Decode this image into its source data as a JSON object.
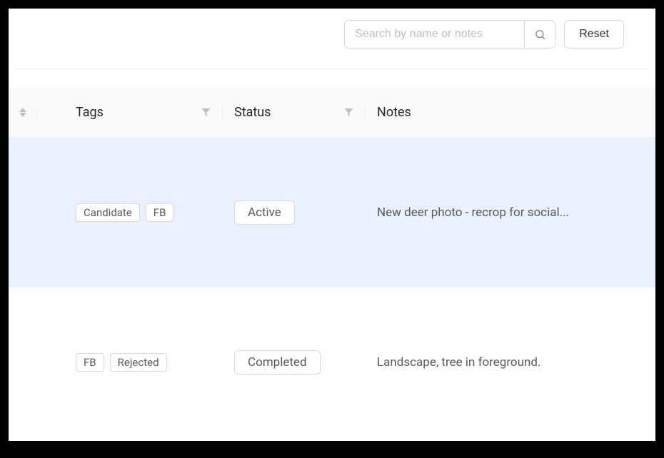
{
  "toolbar": {
    "search_placeholder": "Search by name or notes",
    "reset_label": "Reset"
  },
  "columns": {
    "tags": "Tags",
    "status": "Status",
    "notes": "Notes"
  },
  "rows": [
    {
      "tags": [
        "Candidate",
        "FB"
      ],
      "status": "Active",
      "notes": "New deer photo - recrop for social...",
      "highlight": true
    },
    {
      "tags": [
        "FB",
        "Rejected"
      ],
      "status": "Completed",
      "notes": "Landscape, tree in foreground.",
      "highlight": false
    }
  ]
}
